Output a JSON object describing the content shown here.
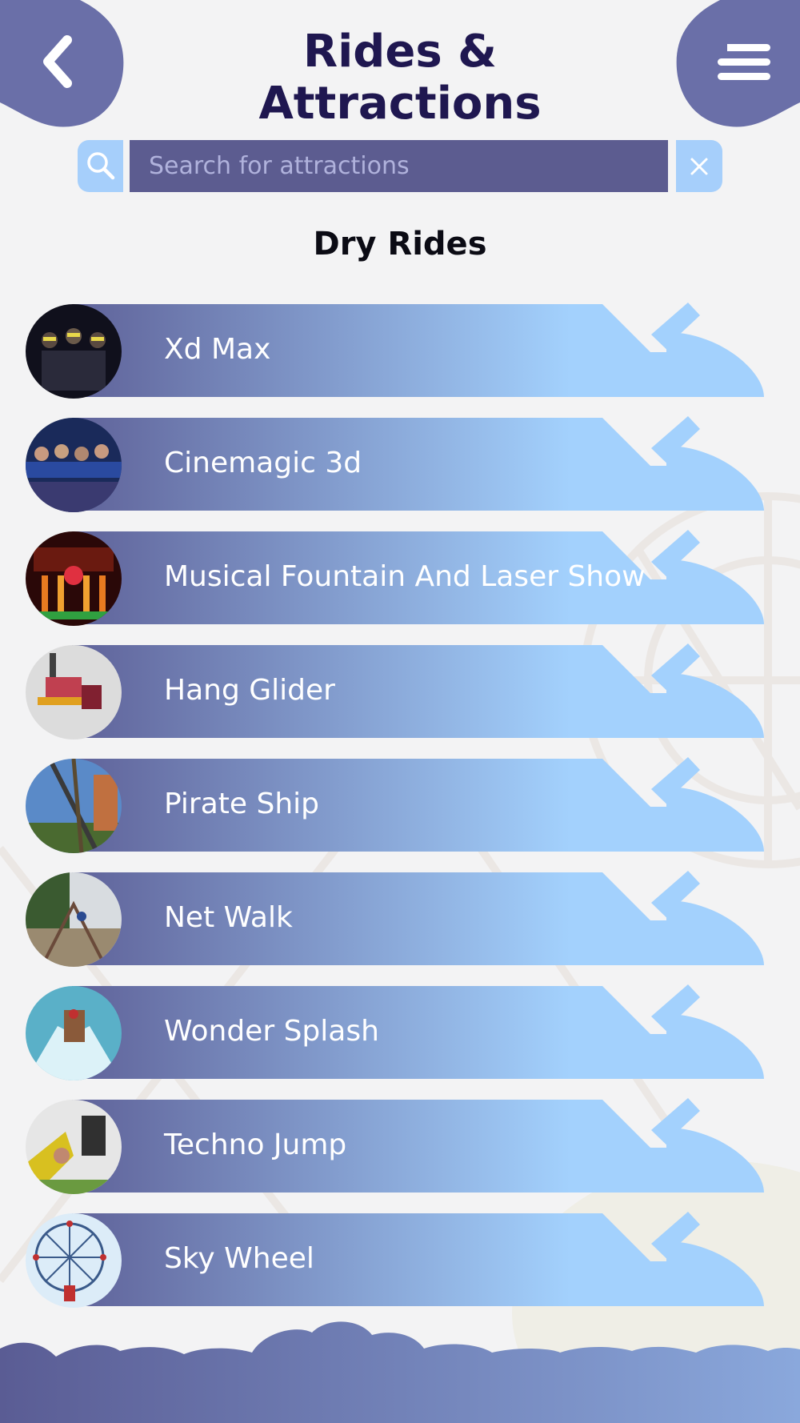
{
  "header": {
    "title": "Rides & Attractions",
    "back_icon": "chevron-left-icon",
    "menu_icon": "menu-icon"
  },
  "search": {
    "placeholder": "Search for attractions",
    "value": "",
    "search_icon": "search-icon",
    "clear_icon": "close-icon"
  },
  "section": {
    "title": "Dry Rides"
  },
  "rides": [
    {
      "name": "Xd Max",
      "thumbnail": "dark-theater-audience"
    },
    {
      "name": "Cinemagic 3d",
      "thumbnail": "3d-cinema-audience"
    },
    {
      "name": "Musical Fountain And Laser Show",
      "thumbnail": "fountain-laser-show"
    },
    {
      "name": "Hang Glider",
      "thumbnail": "hang-glider-ride"
    },
    {
      "name": "Pirate Ship",
      "thumbnail": "pirate-ship-ride"
    },
    {
      "name": "Net Walk",
      "thumbnail": "net-walk-ride"
    },
    {
      "name": "Wonder Splash",
      "thumbnail": "water-splash-ride"
    },
    {
      "name": "Techno Jump",
      "thumbnail": "techno-jump-ride"
    },
    {
      "name": "Sky Wheel",
      "thumbnail": "ferris-wheel"
    }
  ],
  "colors": {
    "banner_start": "#5f6299",
    "banner_end": "#a3d1fd",
    "header_blob": "#5f6299",
    "title": "#1f1750",
    "search_field": "#5c5c90",
    "search_accent": "#a6cffb"
  }
}
